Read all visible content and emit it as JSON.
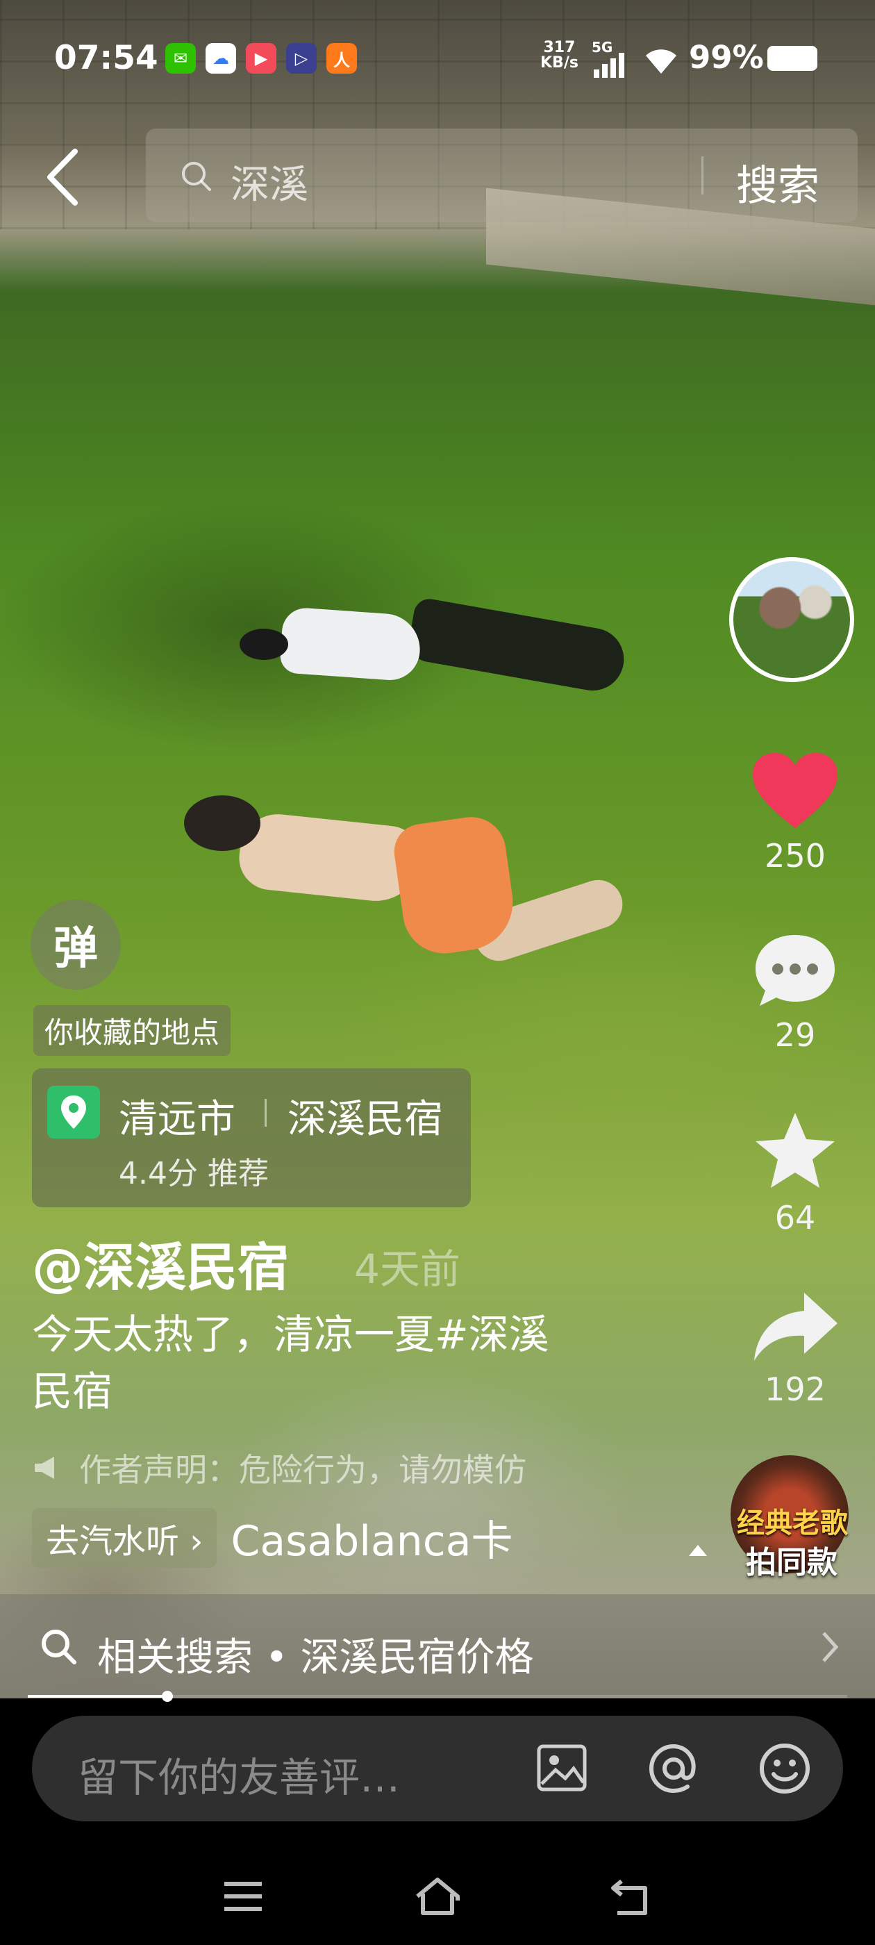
{
  "status_bar": {
    "time": "07:54",
    "net_speed_value": "317",
    "net_speed_unit": "KB/s",
    "network_type": "5G",
    "battery": "99%",
    "app_icons": [
      "wechat-icon",
      "baidu-netdisk-icon",
      "video-app-icon",
      "player-app-icon",
      "orange-app-icon"
    ]
  },
  "search": {
    "query": "深溪",
    "button_label": "搜索"
  },
  "rail": {
    "likes": "250",
    "comments": "29",
    "favorites": "64",
    "shares": "192",
    "like_color": "#f0385a"
  },
  "overlay": {
    "danmu_label": "弹",
    "fav_tag": "你收藏的地点",
    "poi_city": "清远市",
    "poi_name": "深溪民宿",
    "poi_rating": "4.4分 推荐",
    "author": "@深溪民宿",
    "time_ago": "4天前",
    "caption": "今天太热了，清凉一夏#深溪民宿",
    "disclaimer": "作者声明：危险行为，请勿模仿",
    "music_chip": "去汽水听",
    "music_title": "Casablanca卡",
    "disc_label": "经典老歌",
    "same_style_label": "拍同款"
  },
  "related_search": {
    "text": "相关搜索 • 深溪民宿价格"
  },
  "progress": {
    "fraction": 0.17
  },
  "comment": {
    "placeholder": "留下你的友善评…"
  }
}
